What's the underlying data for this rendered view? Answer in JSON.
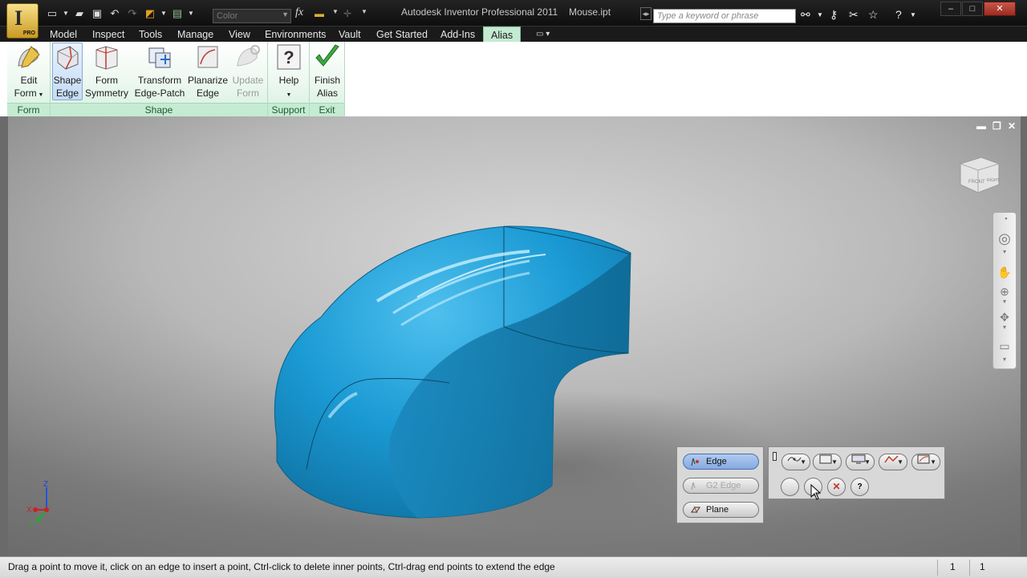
{
  "titlebar": {
    "app_title": "Autodesk Inventor Professional 2011",
    "file_name": "Mouse.ipt",
    "app_letter": "I",
    "app_badge": "PRO",
    "color_combo": "Color",
    "fx": "fx",
    "search_placeholder": "Type a keyword or phrase",
    "window_minimize": "–",
    "window_maximize": "□",
    "window_close": "✕"
  },
  "menu": {
    "items": [
      "Model",
      "Inspect",
      "Tools",
      "Manage",
      "View",
      "Environments",
      "Vault",
      "Get Started",
      "Add-Ins",
      "Alias"
    ],
    "active": "Alias"
  },
  "ribbon": {
    "panels": [
      {
        "label": "Form",
        "buttons": [
          {
            "line1": "Edit",
            "line2": "Form",
            "icon": "edit-form-icon"
          }
        ]
      },
      {
        "label": "Shape",
        "buttons": [
          {
            "line1": "Shape",
            "line2": "Edge",
            "icon": "shape-edge-icon",
            "selected": true
          },
          {
            "line1": "Form",
            "line2": "Symmetry",
            "icon": "form-symmetry-icon"
          },
          {
            "line1": "Transform",
            "line2": "Edge-Patch",
            "icon": "transform-edge-patch-icon"
          },
          {
            "line1": "Planarize",
            "line2": "Edge",
            "icon": "planarize-edge-icon"
          },
          {
            "line1": "Update",
            "line2": "Form",
            "icon": "update-form-icon",
            "disabled": true
          }
        ]
      },
      {
        "label": "Support",
        "buttons": [
          {
            "line1": "Help",
            "line2": "",
            "icon": "help-icon"
          }
        ]
      },
      {
        "label": "Exit",
        "buttons": [
          {
            "line1": "Finish",
            "line2": "Alias",
            "icon": "finish-checkmark-icon"
          }
        ]
      }
    ]
  },
  "shape_panel": {
    "buttons": [
      {
        "label": "Edge",
        "active": true
      },
      {
        "label": "G2 Edge",
        "disabled": true
      },
      {
        "label": "Plane"
      }
    ]
  },
  "triad": {
    "x": "X",
    "y": "Y",
    "z": "Z"
  },
  "viewcube": {
    "front": "FRONT",
    "right": "RIGHT"
  },
  "statusbar": {
    "message": "Drag a point to move it, click on an edge to insert a point, Ctrl-click to delete inner points, Ctrl-drag end points to extend the edge",
    "field1": "1",
    "field2": "1"
  },
  "colors": {
    "model": "#1f9fd6",
    "ribbon_accent": "#c4ead2"
  }
}
